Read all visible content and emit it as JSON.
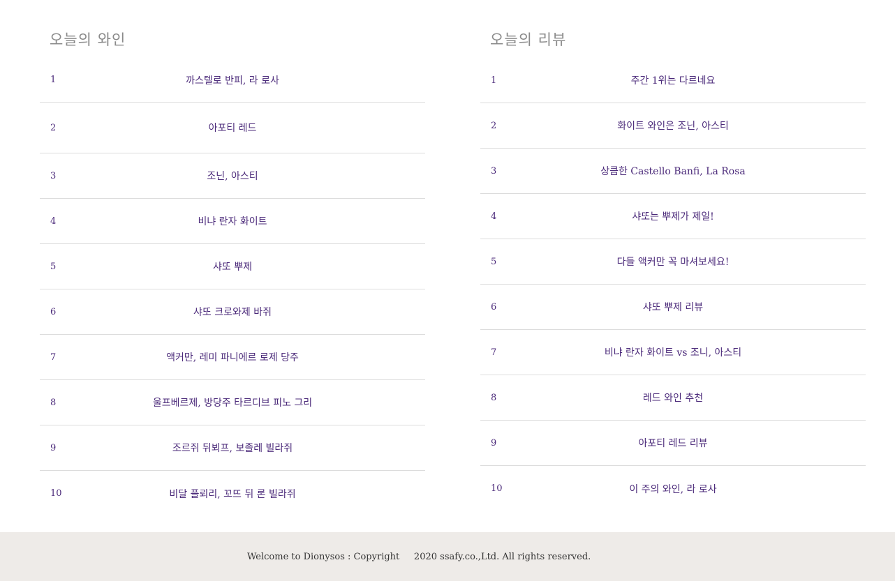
{
  "wine_ranking": {
    "title": "오늘의 와인",
    "items": [
      {
        "rank": "1",
        "name": "까스텔로 반피, 라 로사"
      },
      {
        "rank": "2",
        "name": "아포티 레드"
      },
      {
        "rank": "3",
        "name": "조닌, 아스티"
      },
      {
        "rank": "4",
        "name": "비냐 란자 화이트"
      },
      {
        "rank": "5",
        "name": "샤또 뿌제"
      },
      {
        "rank": "6",
        "name": "샤또 크로와제 바쥐"
      },
      {
        "rank": "7",
        "name": "액커만, 레미 파니에르 로제 당주"
      },
      {
        "rank": "8",
        "name": "울프베르제, 방당주 타르디브 피노 그리"
      },
      {
        "rank": "9",
        "name": "조르쥐 뒤뵈프, 보졸레 빌라쥐"
      },
      {
        "rank": "10",
        "name": "비달 플뢰리, 꼬뜨 뒤 론 빌라쥐"
      }
    ]
  },
  "review_ranking": {
    "title": "오늘의 리뷰",
    "items": [
      {
        "rank": "1",
        "name": "주간 1위는 다르네요"
      },
      {
        "rank": "2",
        "name": "화이트 와인은 조닌, 아스티"
      },
      {
        "rank": "3",
        "name": "상큼한 Castello Banfi, La Rosa"
      },
      {
        "rank": "4",
        "name": "샤또는 뿌제가 제일!"
      },
      {
        "rank": "5",
        "name": "다들 액커만 꼭 마셔보세요!"
      },
      {
        "rank": "6",
        "name": "샤또 뿌제 리뷰"
      },
      {
        "rank": "7",
        "name": "비냐 란자 화이트 vs 조니, 아스티"
      },
      {
        "rank": "8",
        "name": "레드 와인 추천"
      },
      {
        "rank": "9",
        "name": "아포티 레드 리뷰"
      },
      {
        "rank": "10",
        "name": "이 주의 와인, 라 로사"
      }
    ]
  },
  "footer": {
    "text": "Welcome to Dionysos : Copyright     2020 ssafy.co.,Ltd. All rights reserved."
  },
  "colors": {
    "accent": "#4b2a7a",
    "heading": "#8a8a8a",
    "footer_bg": "#eeebe8"
  }
}
